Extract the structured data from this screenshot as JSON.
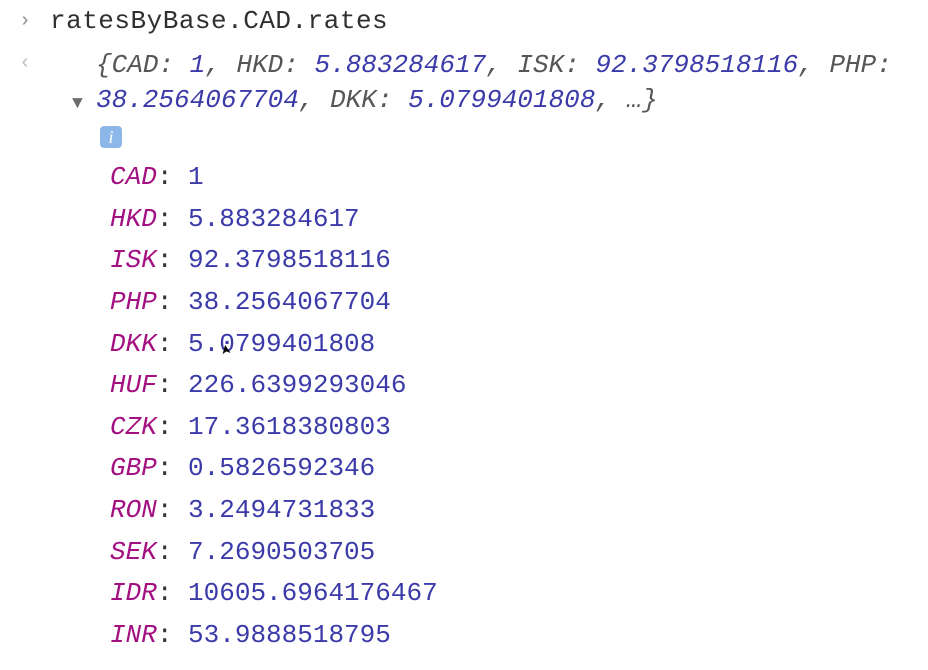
{
  "input": {
    "expression": "ratesByBase.CAD.rates"
  },
  "output": {
    "summary": {
      "pairs": [
        {
          "k": "CAD",
          "v": "1"
        },
        {
          "k": "HKD",
          "v": "5.883284617"
        },
        {
          "k": "ISK",
          "v": "92.3798518116"
        },
        {
          "k": "PHP",
          "v": "38.2564067704"
        },
        {
          "k": "DKK",
          "v": "5.0799401808"
        }
      ],
      "open": "{",
      "close": "}",
      "ellipsis": "…"
    },
    "info_glyph": "i",
    "entries": [
      {
        "k": "CAD",
        "v": "1"
      },
      {
        "k": "HKD",
        "v": "5.883284617"
      },
      {
        "k": "ISK",
        "v": "92.3798518116"
      },
      {
        "k": "PHP",
        "v": "38.2564067704"
      },
      {
        "k": "DKK",
        "v": "5.0799401808"
      },
      {
        "k": "HUF",
        "v": "226.6399293046"
      },
      {
        "k": "CZK",
        "v": "17.3618380803"
      },
      {
        "k": "GBP",
        "v": "0.5826592346"
      },
      {
        "k": "RON",
        "v": "3.2494731833"
      },
      {
        "k": "SEK",
        "v": "7.2690503705"
      },
      {
        "k": "IDR",
        "v": "10605.6964176467"
      },
      {
        "k": "INR",
        "v": "53.9888518795"
      }
    ]
  },
  "glyphs": {
    "input_chevron": "›",
    "output_chevron": "‹",
    "triangle_down": "▼"
  }
}
